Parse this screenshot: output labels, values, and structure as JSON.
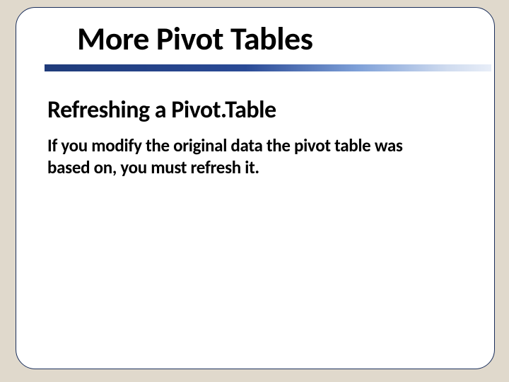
{
  "slide": {
    "title": "More Pivot Tables",
    "subtitle": "Refreshing a Pivot.Table",
    "body": "If you modify the original data the pivot table was based on, you must refresh it."
  }
}
